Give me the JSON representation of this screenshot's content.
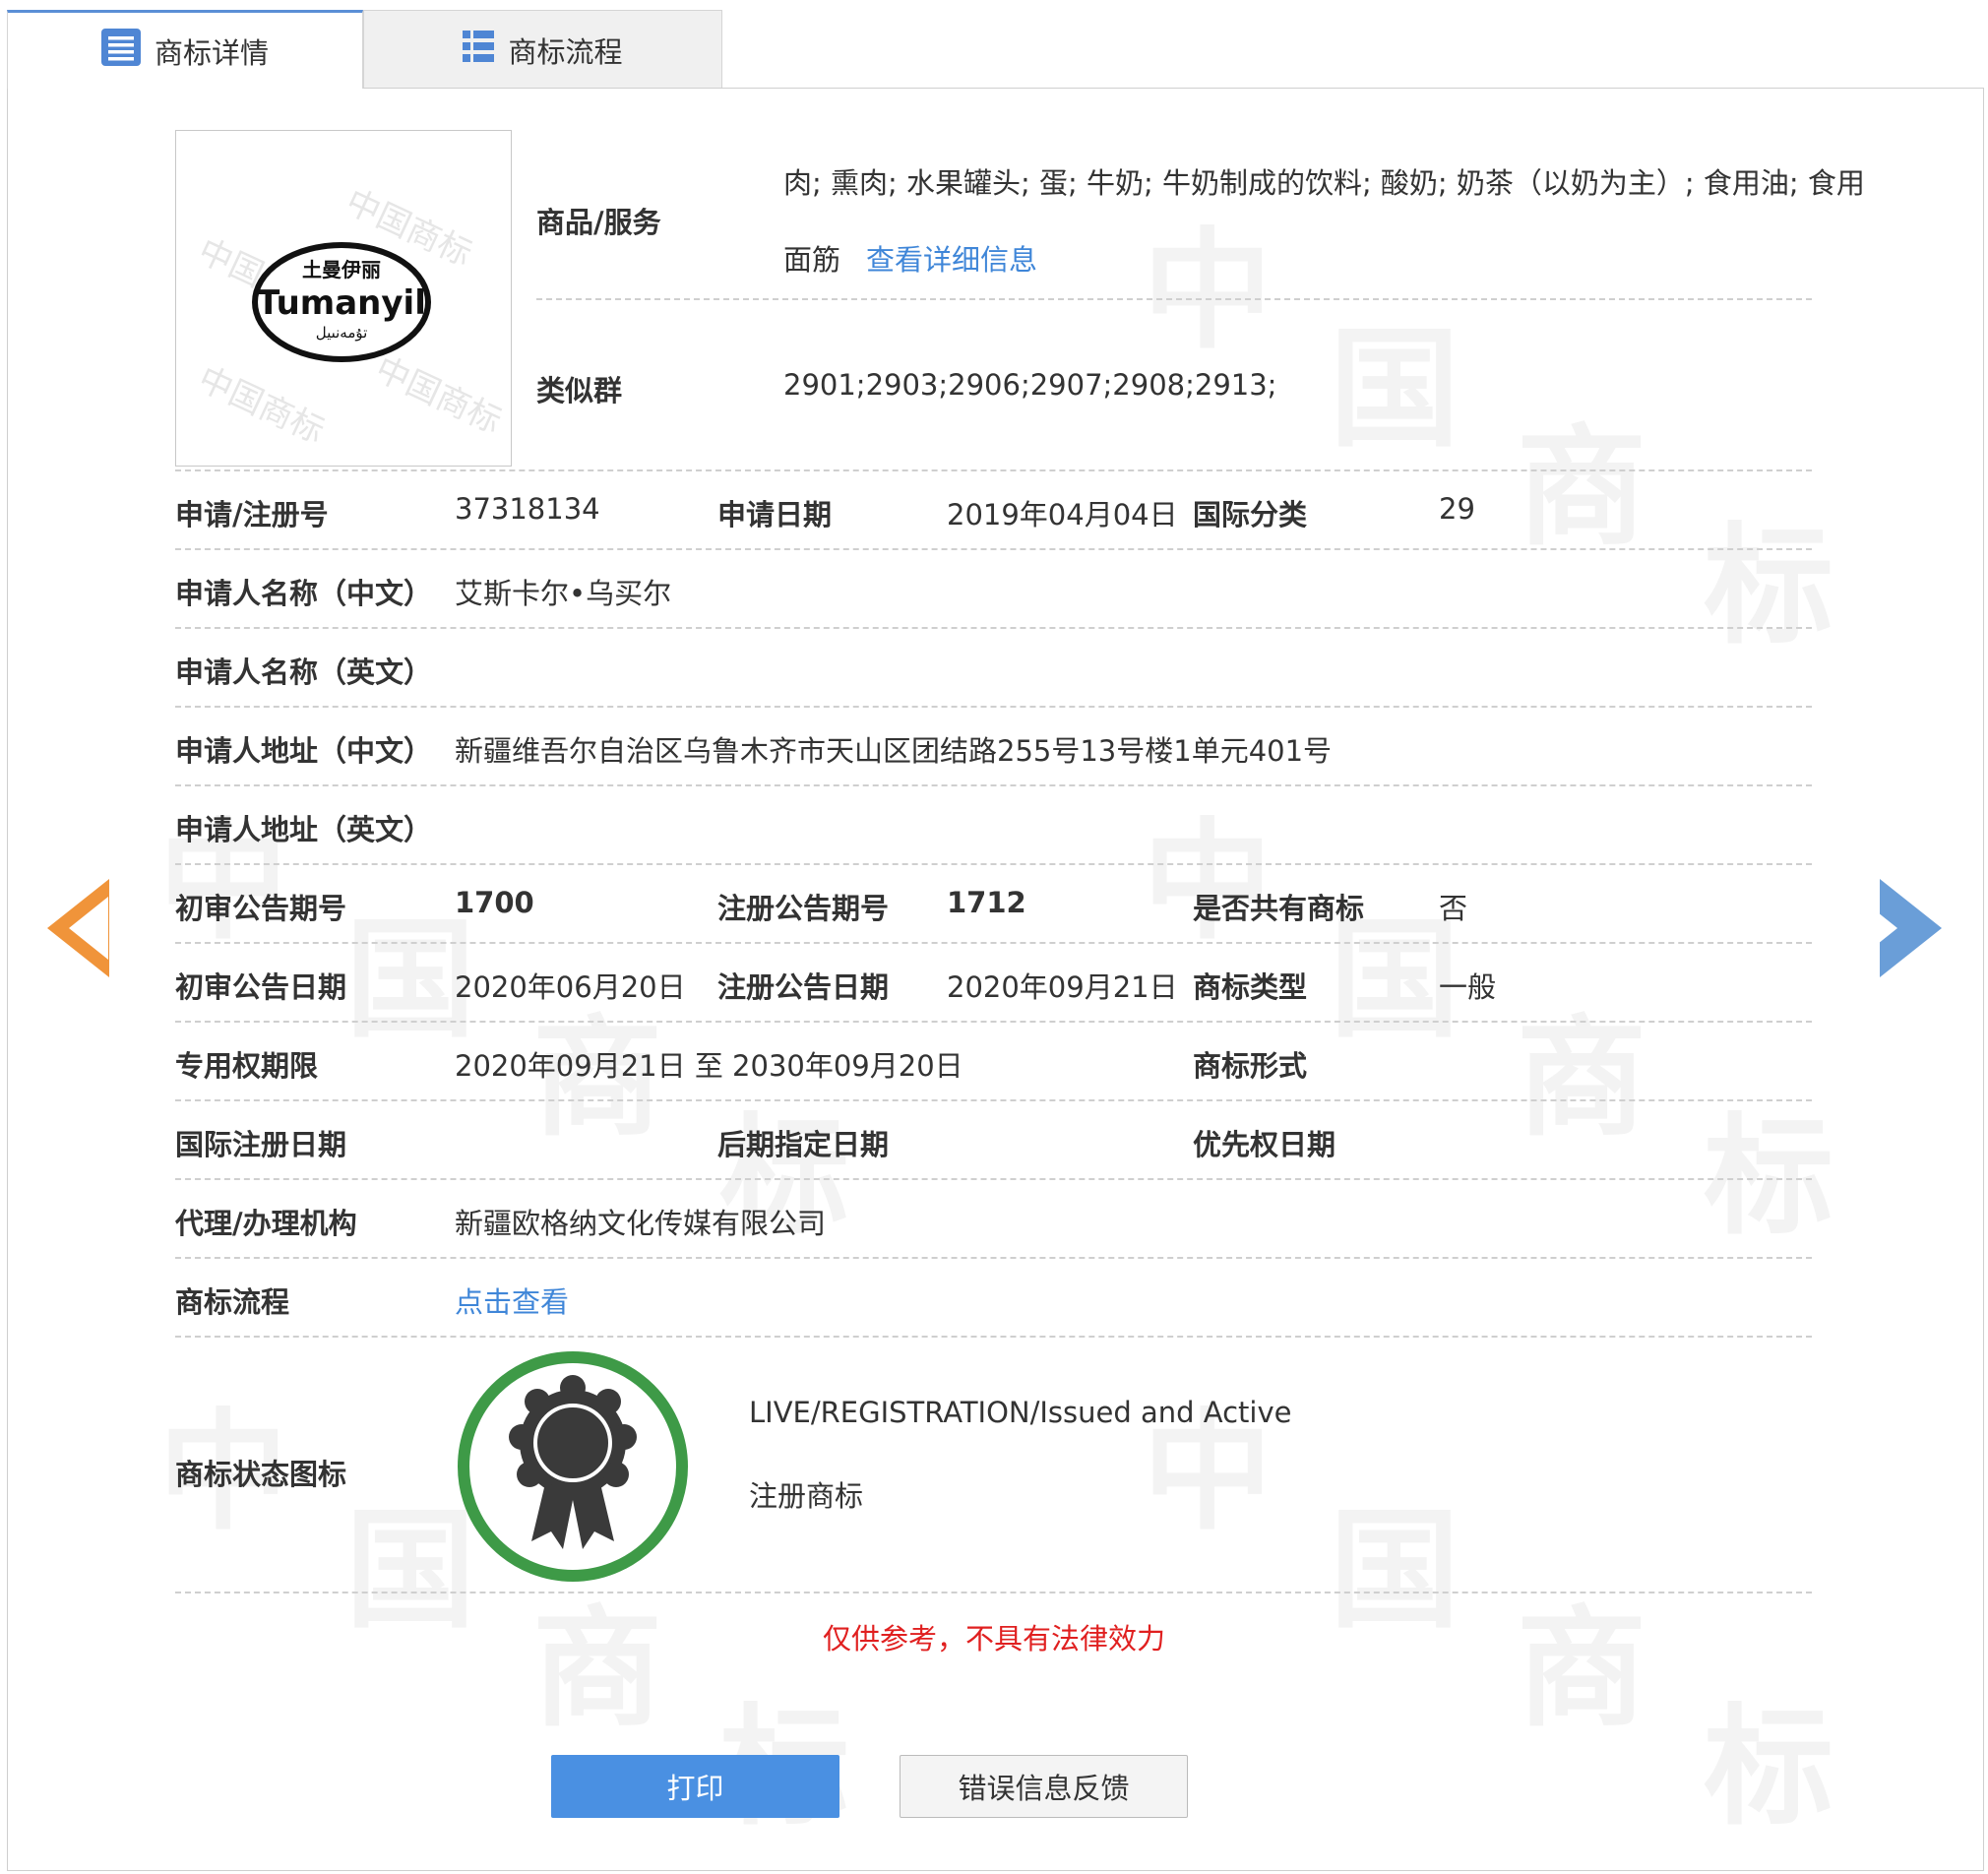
{
  "tabs": {
    "detail": "商标详情",
    "process": "商标流程"
  },
  "watermark": [
    "中",
    "国",
    "商",
    "标"
  ],
  "logo": {
    "chinese_text": "土曼伊丽",
    "latin_text": "Tumanyil",
    "script_text": "تۇمەنىيل",
    "wm_small": "中国商标"
  },
  "goods": {
    "label": "商品/服务",
    "line1": "肉; 熏肉; 水果罐头; 蛋; 牛奶; 牛奶制成的饮料; 酸奶; 奶茶（以奶为主）; 食用油; 食用",
    "line2": "面筋",
    "detail_link": "查看详细信息"
  },
  "similar_group": {
    "label": "类似群",
    "value": "2901;2903;2906;2907;2908;2913;"
  },
  "fields": {
    "reg_no_label": "申请/注册号",
    "reg_no": "37318134",
    "apply_date_label": "申请日期",
    "apply_date": "2019年04月04日",
    "intl_class_label": "国际分类",
    "intl_class": "29",
    "applicant_cn_label": "申请人名称（中文）",
    "applicant_cn": "艾斯卡尔•乌买尔",
    "applicant_en_label": "申请人名称（英文）",
    "applicant_en": "",
    "address_cn_label": "申请人地址（中文）",
    "address_cn": "新疆维吾尔自治区乌鲁木齐市天山区团结路255号13号楼1单元401号",
    "address_en_label": "申请人地址（英文）",
    "address_en": "",
    "prelim_no_label": "初审公告期号",
    "prelim_no": "1700",
    "reg_pub_no_label": "注册公告期号",
    "reg_pub_no": "1712",
    "shared_label": "是否共有商标",
    "shared": "否",
    "prelim_date_label": "初审公告日期",
    "prelim_date": "2020年06月20日",
    "reg_pub_date_label": "注册公告日期",
    "reg_pub_date": "2020年09月21日",
    "tm_type_label": "商标类型",
    "tm_type": "一般",
    "exclusive_label": "专用权期限",
    "exclusive": "2020年09月21日 至 2030年09月20日",
    "tm_form_label": "商标形式",
    "tm_form": "",
    "intl_reg_date_label": "国际注册日期",
    "later_date_label": "后期指定日期",
    "priority_date_label": "优先权日期",
    "agent_label": "代理/办理机构",
    "agent": "新疆欧格纳文化传媒有限公司",
    "process_label": "商标流程",
    "process_link": "点击查看"
  },
  "status": {
    "label": "商标状态图标",
    "line1": "LIVE/REGISTRATION/Issued and Active",
    "line2": "注册商标",
    "badge_color": "#3e9a47"
  },
  "notice": "仅供参考，不具有法律效力",
  "buttons": {
    "print": "打印",
    "feedback": "错误信息反馈"
  },
  "colors": {
    "link": "#3f86d8",
    "primary_button": "#4a90e2",
    "notice": "#e02020",
    "prev_arrow": "#f0943a",
    "next_arrow": "#6a9ed8"
  }
}
